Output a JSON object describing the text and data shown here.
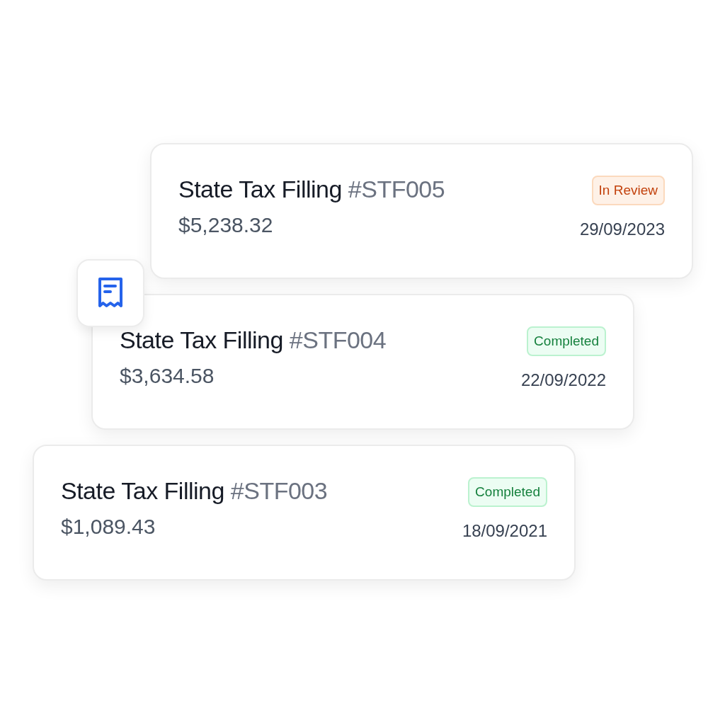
{
  "filings": [
    {
      "title": "State Tax Filling",
      "number": "#STF005",
      "amount": "$5,238.32",
      "date": "29/09/2023",
      "status": {
        "kind": "review",
        "label": "In Review"
      }
    },
    {
      "title": "State Tax Filling",
      "number": "#STF004",
      "amount": "$3,634.58",
      "date": "22/09/2022",
      "status": {
        "kind": "completed",
        "label": "Completed"
      }
    },
    {
      "title": "State Tax Filling",
      "number": "#STF003",
      "amount": "$1,089.43",
      "date": "18/09/2021",
      "status": {
        "kind": "completed",
        "label": "Completed"
      }
    }
  ]
}
